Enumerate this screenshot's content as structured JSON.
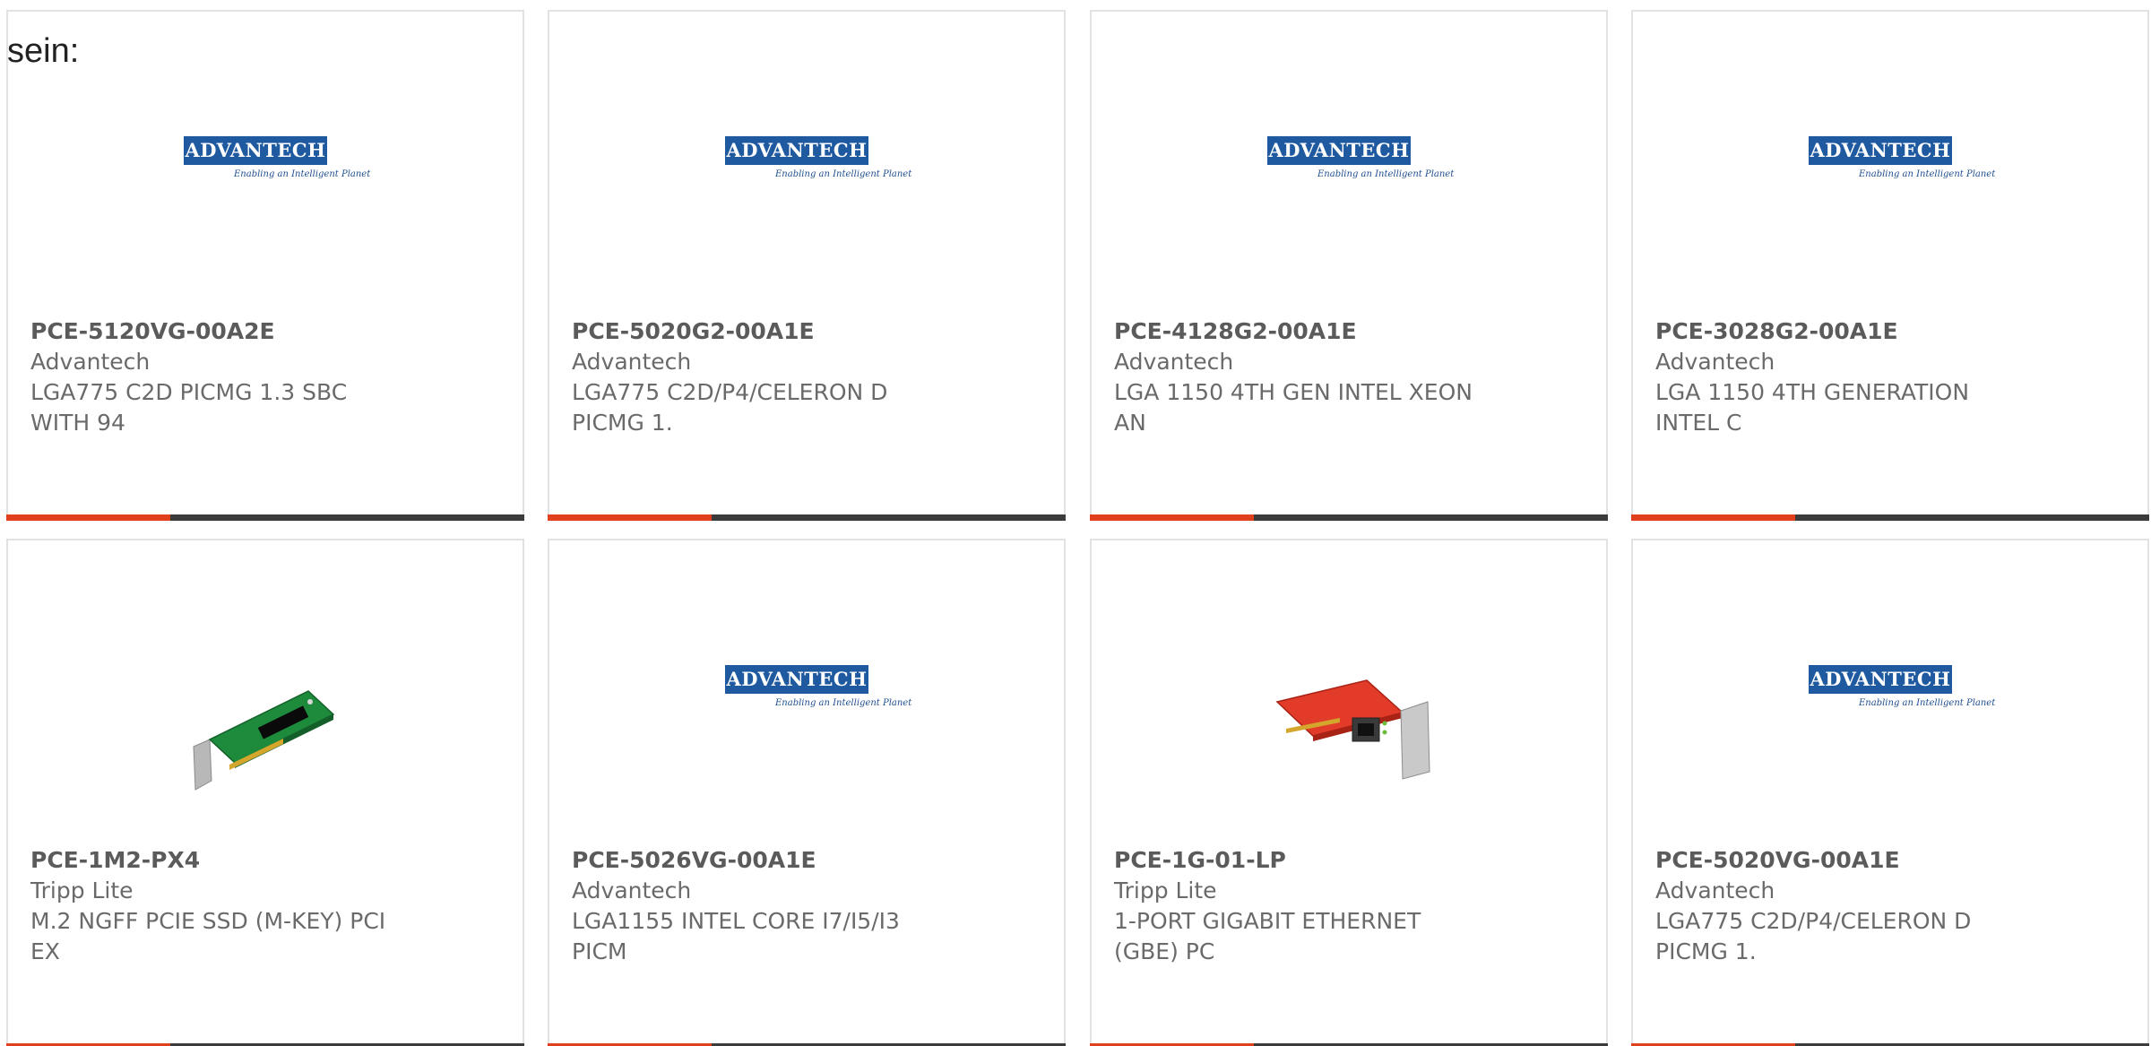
{
  "intro_text": "sein:",
  "logo": {
    "brand_text": "ADVANTECH",
    "tagline": "Enabling an Intelligent Planet"
  },
  "products": [
    {
      "sku": "PCE-5120VG-00A2E",
      "brand": "Advantech",
      "desc": "LGA775 C2D PICMG 1.3 SBC\nWITH 94",
      "image": "advantech-logo"
    },
    {
      "sku": "PCE-5020G2-00A1E",
      "brand": "Advantech",
      "desc": "LGA775 C2D/P4/CELERON D\nPICMG 1.",
      "image": "advantech-logo"
    },
    {
      "sku": "PCE-4128G2-00A1E",
      "brand": "Advantech",
      "desc": "LGA 1150 4TH GEN INTEL XEON\nAN",
      "image": "advantech-logo"
    },
    {
      "sku": "PCE-3028G2-00A1E",
      "brand": "Advantech",
      "desc": "LGA 1150 4TH GENERATION\nINTEL C",
      "image": "advantech-logo"
    },
    {
      "sku": "PCE-1M2-PX4",
      "brand": "Tripp Lite",
      "desc": "M.2 NGFF PCIE SSD (M-KEY) PCI\nEX",
      "image": "green-pcie-card"
    },
    {
      "sku": "PCE-5026VG-00A1E",
      "brand": "Advantech",
      "desc": "LGA1155 INTEL CORE I7/I5/I3\nPICM",
      "image": "advantech-logo"
    },
    {
      "sku": "PCE-1G-01-LP",
      "brand": "Tripp Lite",
      "desc": "1-PORT GIGABIT ETHERNET\n(GBE) PC",
      "image": "red-ethernet-card"
    },
    {
      "sku": "PCE-5020VG-00A1E",
      "brand": "Advantech",
      "desc": "LGA775 C2D/P4/CELERON D\nPICMG 1.",
      "image": "advantech-logo"
    }
  ],
  "colors": {
    "accent": "#e0401c",
    "bar": "#3b3b3b",
    "logo_blue": "#1f5aa0",
    "text": "#6a6a6a"
  }
}
